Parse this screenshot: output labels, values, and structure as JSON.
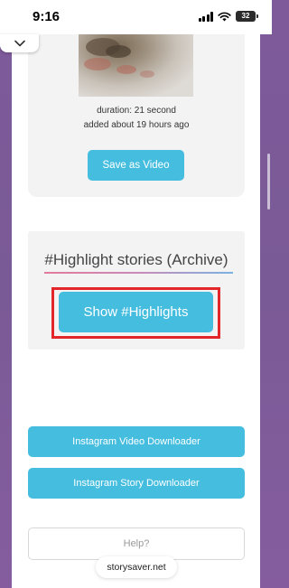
{
  "status_bar": {
    "time": "9:16",
    "battery": "32"
  },
  "story_card": {
    "duration": "duration: 21 second",
    "added": "added about 19 hours ago",
    "save_button": "Save as Video"
  },
  "highlights": {
    "title": "#Highlight stories (Archive)",
    "show_button": "Show #Highlights"
  },
  "links": {
    "video_downloader": "Instagram Video Downloader",
    "story_downloader": "Instagram Story Downloader",
    "help": "Help?"
  },
  "browser": {
    "url": "storysaver.net"
  },
  "colors": {
    "accent": "#45bddf",
    "frame": "#e3262a",
    "background": "#7e5a9b"
  }
}
